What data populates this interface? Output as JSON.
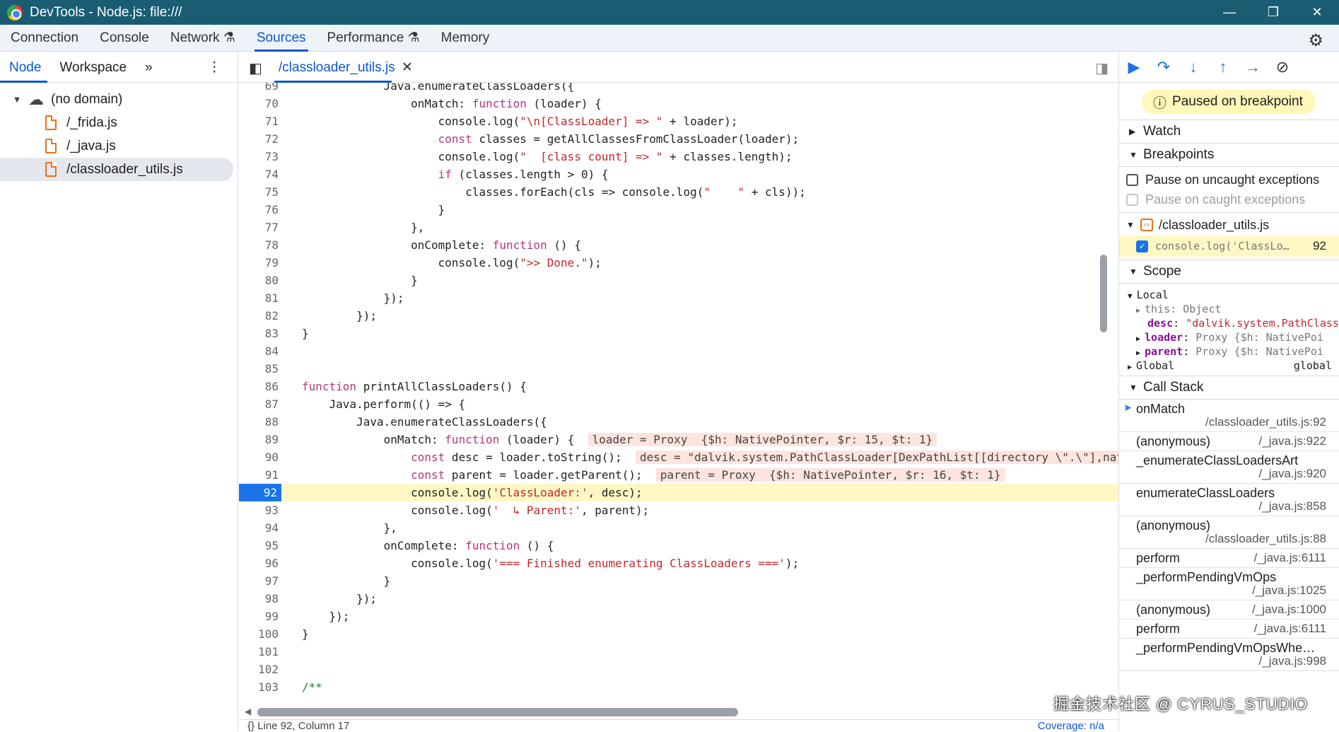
{
  "window": {
    "title": "DevTools - Node.js: file:///",
    "minimize": "—",
    "restore": "❐",
    "close": "✕"
  },
  "main_tabs": [
    {
      "label": "Connection"
    },
    {
      "label": "Console"
    },
    {
      "label": "Network ⚗"
    },
    {
      "label": "Sources"
    },
    {
      "label": "Performance ⚗"
    },
    {
      "label": "Memory"
    }
  ],
  "left_panel": {
    "tabs": [
      "Node",
      "Workspace",
      "»",
      "⋮"
    ],
    "tree": [
      {
        "label": "(no domain)"
      },
      {
        "label": "/_frida.js"
      },
      {
        "label": "/_java.js"
      },
      {
        "label": "/classloader_utils.js"
      }
    ]
  },
  "editor": {
    "file_tab": "/classloader_utils.js",
    "close": "✕",
    "lines": [
      {
        "n": "69",
        "t": "            Java.enumerateClassLoaders({"
      },
      {
        "n": "70",
        "t": "                onMatch: function (loader) {"
      },
      {
        "n": "71",
        "t": "                    console.log(\"\\n[ClassLoader] => \" + loader);"
      },
      {
        "n": "72",
        "t": "                    const classes = getAllClassesFromClassLoader(loader);"
      },
      {
        "n": "73",
        "t": "                    console.log(\"  [class count] => \" + classes.length);"
      },
      {
        "n": "74",
        "t": "                    if (classes.length > 0) {"
      },
      {
        "n": "75",
        "t": "                        classes.forEach(cls => console.log(\"    \" + cls));"
      },
      {
        "n": "76",
        "t": "                    }"
      },
      {
        "n": "77",
        "t": "                },"
      },
      {
        "n": "78",
        "t": "                onComplete: function () {"
      },
      {
        "n": "79",
        "t": "                    console.log(\">> Done.\");"
      },
      {
        "n": "80",
        "t": "                }"
      },
      {
        "n": "81",
        "t": "            });"
      },
      {
        "n": "82",
        "t": "        });"
      },
      {
        "n": "83",
        "t": "}"
      },
      {
        "n": "84",
        "t": ""
      },
      {
        "n": "85",
        "t": ""
      },
      {
        "n": "86",
        "t": "function printAllClassLoaders() {"
      },
      {
        "n": "87",
        "t": "    Java.perform(() => {"
      },
      {
        "n": "88",
        "t": "        Java.enumerateClassLoaders({"
      },
      {
        "n": "89",
        "t": "            onMatch: function (loader) {",
        "inline": "loader = Proxy  {$h: NativePointer, $r: 15, $t: 1}"
      },
      {
        "n": "90",
        "t": "                const desc = loader.toString();",
        "inline": "desc = \"dalvik.system.PathClassLoader[DexPathList[[directory \\\".\\\"],nativeLib"
      },
      {
        "n": "91",
        "t": "                const parent = loader.getParent();",
        "inline": "parent = Proxy  {$h: NativePointer, $r: 16, $t: 1}"
      },
      {
        "n": "92",
        "t": "                console.log('ClassLoader:', desc);"
      },
      {
        "n": "93",
        "t": "                console.log('  ↳ Parent:', parent);"
      },
      {
        "n": "94",
        "t": "            },"
      },
      {
        "n": "95",
        "t": "            onComplete: function () {"
      },
      {
        "n": "96",
        "t": "                console.log('=== Finished enumerating ClassLoaders ===');"
      },
      {
        "n": "97",
        "t": "            }"
      },
      {
        "n": "98",
        "t": "        });"
      },
      {
        "n": "99",
        "t": "    });"
      },
      {
        "n": "100",
        "t": "}"
      },
      {
        "n": "101",
        "t": ""
      },
      {
        "n": "102",
        "t": ""
      },
      {
        "n": "103",
        "t": "/**"
      }
    ],
    "current_line": "92",
    "status": "{}   Line 92, Column 17",
    "coverage": "Coverage: n/a"
  },
  "debugger": {
    "paused": "Paused on breakpoint",
    "sections": {
      "watch": "Watch",
      "breakpoints": "Breakpoints",
      "scope": "Scope",
      "callstack": "Call Stack"
    },
    "pause_uncaught": "Pause on uncaught exceptions",
    "pause_caught": "Pause on caught exceptions",
    "bp_file": "/classloader_utils.js",
    "bp_line_text": "console.log('ClassLo…",
    "bp_line_num": "92",
    "scope": {
      "local": "Local",
      "this": "this: Object",
      "desc_key": "desc",
      "desc_val": "\"dalvik.system.PathClass",
      "loader_key": "loader",
      "loader_val": "Proxy  {$h: NativePoi",
      "parent_key": "parent",
      "parent_val": "Proxy  {$h: NativePoi",
      "global": "Global",
      "global_val": "global"
    },
    "call_stack": [
      {
        "fn": "onMatch",
        "loc": "/classloader_utils.js:92"
      },
      {
        "fn": "(anonymous)",
        "loc": "/_java.js:922"
      },
      {
        "fn": "_enumerateClassLoadersArt",
        "loc": "/_java.js:920"
      },
      {
        "fn": "enumerateClassLoaders",
        "loc": "/_java.js:858"
      },
      {
        "fn": "(anonymous)",
        "loc": "/classloader_utils.js:88"
      },
      {
        "fn": "perform",
        "loc": "/_java.js:6111"
      },
      {
        "fn": "_performPendingVmOps",
        "loc": "/_java.js:1025"
      },
      {
        "fn": "(anonymous)",
        "loc": "/_java.js:1000"
      },
      {
        "fn": "perform",
        "loc": "/_java.js:6111"
      },
      {
        "fn": "_performPendingVmOpsWhe…",
        "loc": "/_java.js:998"
      }
    ]
  },
  "watermark": "掘金技术社区 @ CYRUS_STUDIO"
}
